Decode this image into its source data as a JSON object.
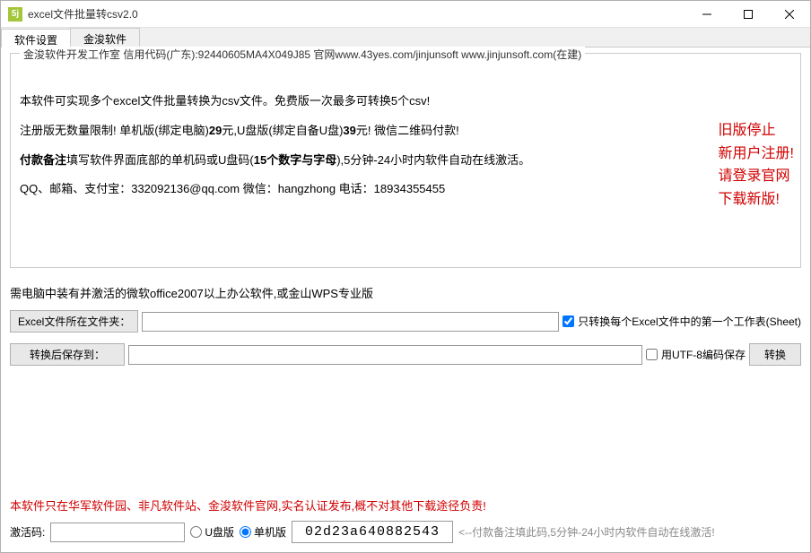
{
  "titlebar": {
    "title": "excel文件批量转csv2.0",
    "icon_text": "5j"
  },
  "tabs": {
    "t1": "软件设置",
    "t2": "金浚软件"
  },
  "info": {
    "legend": "金浚软件开发工作室 信用代码(广东):92440605MA4X049J85 官网www.43yes.com/jinjunsoft  www.jinjunsoft.com(在建)",
    "line1": "本软件可实现多个excel文件批量转换为csv文件。免费版一次最多可转换5个csv!",
    "line2a": "注册版无数量限制! 单机版(绑定电脑)",
    "line2b": "29",
    "line2c": "元,U盘版(绑定自备U盘)",
    "line2d": "39",
    "line2e": "元! 微信二维码付款!",
    "line3a": "付款备注",
    "line3b": "填写软件界面底部的单机码或U盘码(",
    "line3c": "15个数字与字母",
    "line3d": "),5分钟-24小时内软件自动在线激活。",
    "line4": "QQ、邮箱、支付宝：332092136@qq.com  微信：hangzhong   电话：18934355455"
  },
  "side": {
    "l1": "旧版停止",
    "l2": "新用户注册!",
    "l3": "请登录官网",
    "l4": "下载新版!"
  },
  "req": "需电脑中装有并激活的微软office2007以上办公软件,或金山WPS专业版",
  "row1": {
    "btn": "Excel文件所在文件夹：",
    "value": "",
    "chk": "只转换每个Excel文件中的第一个工作表(Sheet)"
  },
  "row2": {
    "btn": "转换后保存到：",
    "value": "",
    "chk": "用UTF-8编码保存",
    "convert": "转换"
  },
  "warning": "本软件只在华军软件园、非凡软件站、金浚软件官网,实名认证发布,概不对其他下载途径负责!",
  "bottom": {
    "label": "激活码:",
    "value": "",
    "r1": "U盘版",
    "r2": "单机版",
    "code": "02d23a640882543",
    "hint": "<--付款备注填此码,5分钟-24小时内软件自动在线激活!"
  }
}
